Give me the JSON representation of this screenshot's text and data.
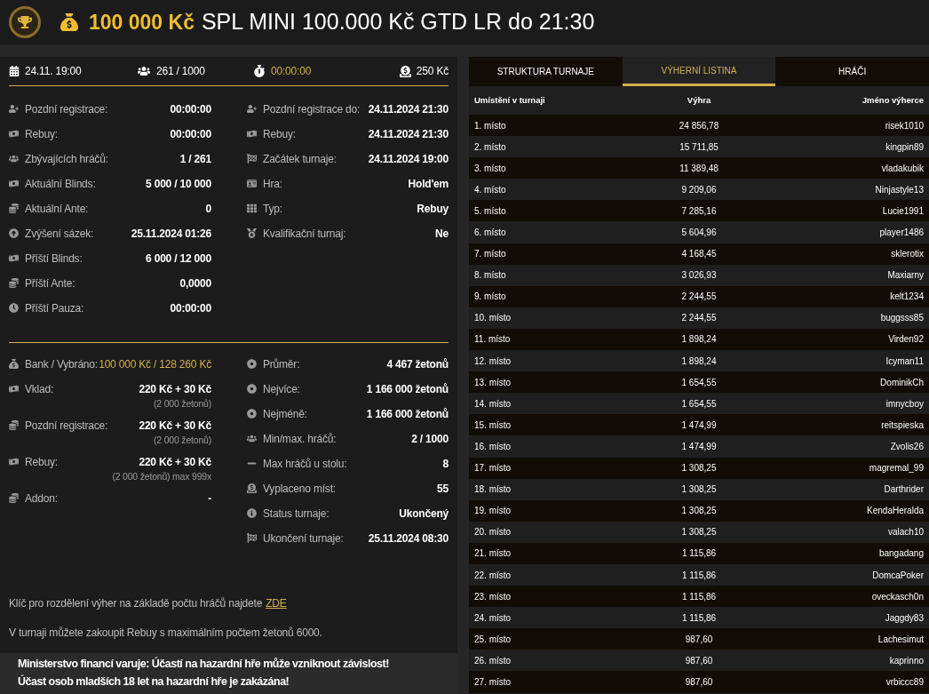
{
  "header": {
    "prize": "100 000 Kč",
    "title": "SPL MINI 100.000 Kč GTD LR do 21:30"
  },
  "summary": {
    "start": "24.11. 19:00",
    "players": "261 / 1000",
    "timer": "00:00:00",
    "buyin": "250 Kč"
  },
  "details_left": [
    {
      "label": "Pozdní registrace:",
      "value": "00:00:00"
    },
    {
      "label": "Rebuy:",
      "value": "00:00:00"
    },
    {
      "label": "Zbývajících hráčů:",
      "value": "1 / 261"
    },
    {
      "label": "Aktuální Blinds:",
      "value": "5 000 / 10 000"
    },
    {
      "label": "Aktuální Ante:",
      "value": "0"
    },
    {
      "label": "Zvýšení sázek:",
      "value": "25.11.2024 01:26"
    },
    {
      "label": "Příští Blinds:",
      "value": "6 000 / 12 000"
    },
    {
      "label": "Příští Ante:",
      "value": "0,0000"
    },
    {
      "label": "Příští Pauza:",
      "value": "00:00:00"
    }
  ],
  "details_right": [
    {
      "label": "Pozdní registrace do:",
      "value": "24.11.2024 21:30"
    },
    {
      "label": "Rebuy:",
      "value": "24.11.2024 21:30"
    },
    {
      "label": "Začátek turnaje:",
      "value": "24.11.2024 19:00"
    },
    {
      "label": "Hra:",
      "value": "Hold'em"
    },
    {
      "label": "Typ:",
      "value": "Rebuy"
    },
    {
      "label": "Kvalifikační turnaj:",
      "value": "Ne"
    }
  ],
  "bank": {
    "label": "Bank / Vybráno:",
    "value": "100 000 Kč / 128 260 Kč"
  },
  "finance_left": [
    {
      "label": "Vklad:",
      "value": "220 Kč + 30 Kč",
      "note": "(2 000 žetonů)"
    },
    {
      "label": "Pozdní registrace:",
      "value": "220 Kč + 30 Kč",
      "note": "(2 000 žetonů)"
    },
    {
      "label": "Rebuy:",
      "value": "220 Kč + 30 Kč",
      "note": "(2 000 žetonů) max 999x"
    },
    {
      "label": "Addon:",
      "value": "-"
    }
  ],
  "finance_right": [
    {
      "label": "Průměr:",
      "value": "4 467 žetonů"
    },
    {
      "label": "Nejvíce:",
      "value": "1 166 000 žetonů"
    },
    {
      "label": "Nejméně:",
      "value": "1 166 000 žetonů"
    },
    {
      "label": "Min/max. hráčů:",
      "value": "2 / 1000"
    },
    {
      "label": "Max hráčů u stolu:",
      "value": "8"
    },
    {
      "label": "Vyplaceno míst:",
      "value": "55"
    },
    {
      "label": "Status turnaje:",
      "value": "Ukončený"
    },
    {
      "label": "Ukončení turnaje:",
      "value": "25.11.2024 08:30"
    }
  ],
  "notes": {
    "key_text": "Klíč pro rozdělení výher na základě počtu hráčů najdete",
    "key_link": "ZDE",
    "rebuy_text": "V turnaji můžete zakoupit Rebuy s maximálním počtem žetonů 6000."
  },
  "warning": [
    "Ministerstvo financí varuje: Účastí na hazardní hře může vzniknout závislost!",
    "Účast osob mladších 18 let na hazardní hře je zakázána!"
  ],
  "tabs": [
    {
      "label": "STRUKTURA TURNAJE",
      "selected": false
    },
    {
      "label": "VÝHERNÍ LISTINA",
      "selected": true
    },
    {
      "label": "HRÁČI",
      "selected": false
    }
  ],
  "table": {
    "columns": [
      "Umístění v turnaji",
      "Výhra",
      "Jméno výherce"
    ],
    "rows": [
      [
        "1. místo",
        "24 856,78",
        "risek1010"
      ],
      [
        "2. místo",
        "15 711,85",
        "kingpin89"
      ],
      [
        "3. místo",
        "11 389,48",
        "vladakubik"
      ],
      [
        "4. místo",
        "9 209,06",
        "Ninjastyle13"
      ],
      [
        "5. místo",
        "7 285,16",
        "Lucie1991"
      ],
      [
        "6. místo",
        "5 604,96",
        "player1486"
      ],
      [
        "7. místo",
        "4 168,45",
        "sklerotix"
      ],
      [
        "8. místo",
        "3 026,93",
        "Maxiarny"
      ],
      [
        "9. místo",
        "2 244,55",
        "kelt1234"
      ],
      [
        "10. místo",
        "2 244,55",
        "buggsss85"
      ],
      [
        "11. místo",
        "1 898,24",
        "Virden92"
      ],
      [
        "12. místo",
        "1 898,24",
        "Icyman11"
      ],
      [
        "13. místo",
        "1 654,55",
        "DominikCh"
      ],
      [
        "14. místo",
        "1 654,55",
        "imnycboy"
      ],
      [
        "15. místo",
        "1 474,99",
        "reitspieska"
      ],
      [
        "16. místo",
        "1 474,99",
        "Zvolis26"
      ],
      [
        "17. místo",
        "1 308,25",
        "magremal_99"
      ],
      [
        "18. místo",
        "1 308,25",
        "Darthrider"
      ],
      [
        "19. místo",
        "1 308,25",
        "KendaHeralda"
      ],
      [
        "20. místo",
        "1 308,25",
        "valach10"
      ],
      [
        "21. místo",
        "1 115,86",
        "bangadang"
      ],
      [
        "22. místo",
        "1 115,86",
        "DomcaPoker"
      ],
      [
        "23. místo",
        "1 115,86",
        "oveckasch0n"
      ],
      [
        "24. místo",
        "1 115,86",
        "Jaggdy83"
      ],
      [
        "25. místo",
        "987,60",
        "Lachesimut"
      ],
      [
        "26. místo",
        "987,60",
        "kaprinno"
      ],
      [
        "27. místo",
        "987,60",
        "vrbiccc89"
      ]
    ]
  }
}
